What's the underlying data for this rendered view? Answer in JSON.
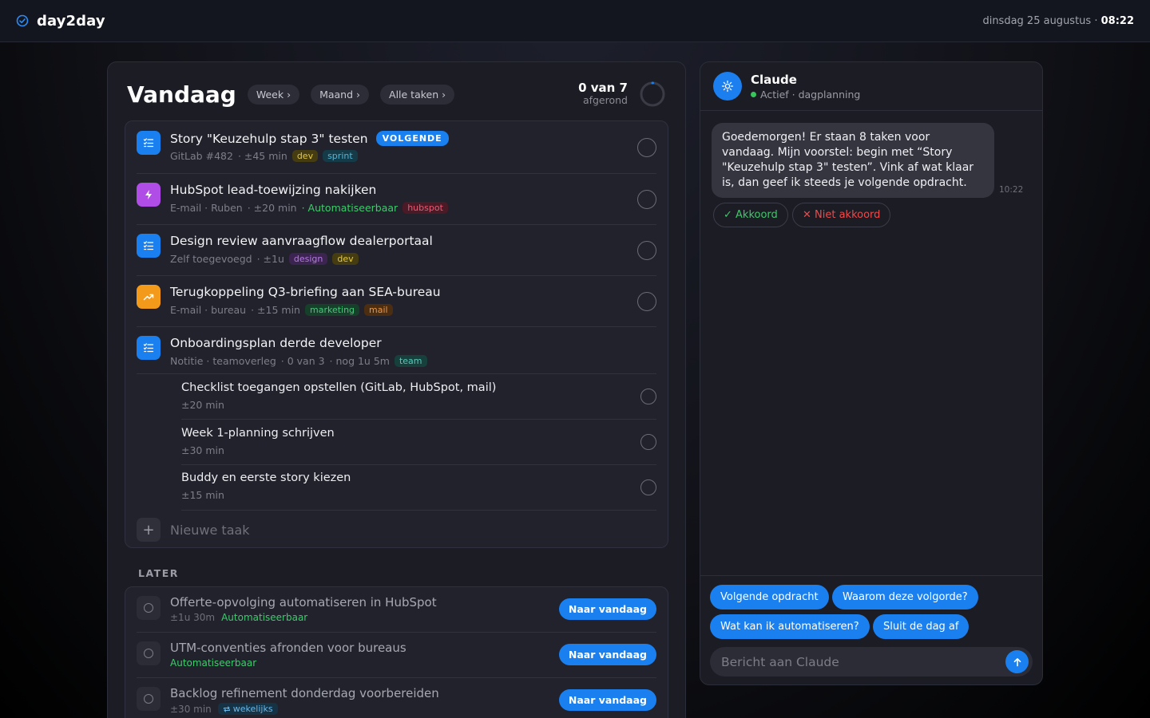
{
  "app": {
    "name": "day2day",
    "date": "dinsdag 25 augustus",
    "separator": "·",
    "time": "08:22"
  },
  "colors": {
    "accent": "#1a80f0",
    "auto": "#3ecb6c",
    "purple": "#b04de6",
    "orange": "#f39a1b"
  },
  "header": {
    "title": "Vandaag",
    "links": [
      "Week ›",
      "Maand ›",
      "Alle taken ›"
    ],
    "progress_main": "0 van 7",
    "progress_sub": "afgerond",
    "progress_done": 0,
    "progress_total": 7
  },
  "tasks": [
    {
      "icon": "checklist-icon",
      "title": "Story \"Keuzehulp stap 3\" testen",
      "badge": "VOLGENDE",
      "meta1": "GitLab #482",
      "meta2": "· ±45 min",
      "tag1": "dev",
      "tag2": "sprint"
    },
    {
      "icon": "bolt-icon",
      "title": "HubSpot lead-toewijzing nakijken",
      "meta1": "E-mail · Ruben",
      "meta2": "· ±20 min",
      "auto": "· Automatiseerbaar",
      "tag1": "hubspot"
    },
    {
      "icon": "checklist-icon",
      "title": "Design review aanvraagflow dealerportaal",
      "meta1": "Zelf toegevoegd",
      "meta2": "· ±1u",
      "tag1": "design",
      "tag2": "dev"
    },
    {
      "icon": "trend-icon",
      "title": "Terugkoppeling Q3-briefing aan SEA-bureau",
      "meta1": "E-mail · bureau",
      "meta2": "· ±15 min",
      "tag1": "marketing",
      "tag2": "mail"
    },
    {
      "icon": "checklist-icon",
      "title": "Onboardingsplan derde developer",
      "meta1": "Notitie · teamoverleg",
      "meta2": "· 0 van 3",
      "meta3": "· nog 1u 5m",
      "tag1": "team"
    }
  ],
  "subtasks": [
    {
      "title": "Checklist toegangen opstellen (GitLab, HubSpot, mail)",
      "meta": "±20 min"
    },
    {
      "title": "Week 1-planning schrijven",
      "meta": "±30 min"
    },
    {
      "title": "Buddy en eerste story kiezen",
      "meta": "±15 min"
    }
  ],
  "new_task": {
    "plus": "+",
    "label": "Nieuwe taak"
  },
  "later": {
    "label": "LATER",
    "button": "Naar vandaag",
    "items": [
      {
        "title": "Offerte-opvolging automatiseren in HubSpot",
        "meta": "±1u 30m",
        "auto": "Automatiseerbaar"
      },
      {
        "title": "UTM-conventies afronden voor bureaus",
        "auto": "Automatiseerbaar"
      },
      {
        "title": "Backlog refinement donderdag voorbereiden",
        "meta": "±30 min",
        "recurring": "wekelijks"
      }
    ]
  },
  "chat": {
    "name": "Claude",
    "status": "Actief · dagplanning",
    "message": "Goedemorgen! Er staan 8 taken voor vandaag. Mijn voorstel: begin met “Story \"Keuzehulp stap 3\" testen”. Vink af wat klaar is, dan geef ik steeds je volgende opdracht.",
    "message_time": "10:22",
    "agree": "✓ Akkoord",
    "disagree": "✕ Niet akkoord",
    "quick_replies": [
      "Volgende opdracht",
      "Waarom deze volgorde?",
      "Wat kan ik automatiseren?",
      "Sluit de dag af"
    ],
    "input_placeholder": "Bericht aan Claude"
  }
}
